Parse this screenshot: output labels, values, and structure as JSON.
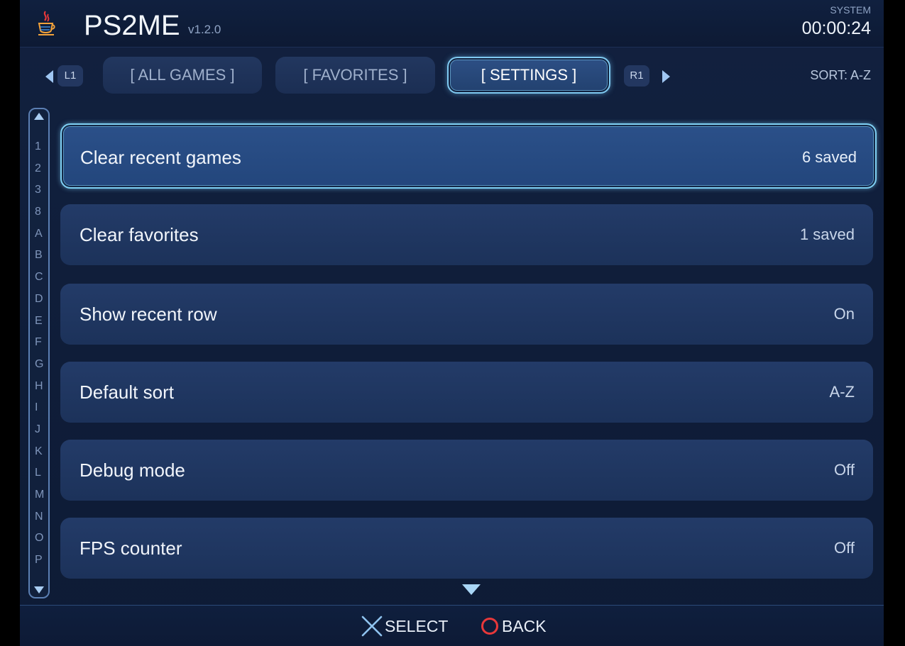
{
  "header": {
    "app_name": "PS2ME",
    "version": "v1.2.0",
    "system_label": "SYSTEM",
    "clock": "00:00:24",
    "logo_icon": "java-cup-icon"
  },
  "tabs": {
    "left_shoulder": "L1",
    "right_shoulder": "R1",
    "items": [
      {
        "label": "[ ALL GAMES ]",
        "active": false
      },
      {
        "label": "[ FAVORITES ]",
        "active": false
      },
      {
        "label": "[ SETTINGS ]",
        "active": true
      }
    ],
    "sort_label": "SORT: A-Z"
  },
  "alpha_index": {
    "letters": [
      "1",
      "2",
      "3",
      "8",
      "A",
      "B",
      "C",
      "D",
      "E",
      "F",
      "G",
      "H",
      "I",
      "J",
      "K",
      "L",
      "M",
      "N",
      "O",
      "P"
    ]
  },
  "settings": [
    {
      "label": "Clear recent games",
      "value": "6 saved",
      "selected": true
    },
    {
      "label": "Clear favorites",
      "value": "1 saved",
      "selected": false
    },
    {
      "label": "Show recent row",
      "value": "On",
      "selected": false
    },
    {
      "label": "Default sort",
      "value": "A-Z",
      "selected": false
    },
    {
      "label": "Debug mode",
      "value": "Off",
      "selected": false
    },
    {
      "label": "FPS counter",
      "value": "Off",
      "selected": false
    }
  ],
  "footer": {
    "select_label": "SELECT",
    "select_icon": "cross-button-icon",
    "back_label": "BACK",
    "back_icon": "circle-button-icon"
  },
  "colors": {
    "accent": "#7fd0f3",
    "cross": "#8fc3ef",
    "circle": "#e8383a"
  }
}
